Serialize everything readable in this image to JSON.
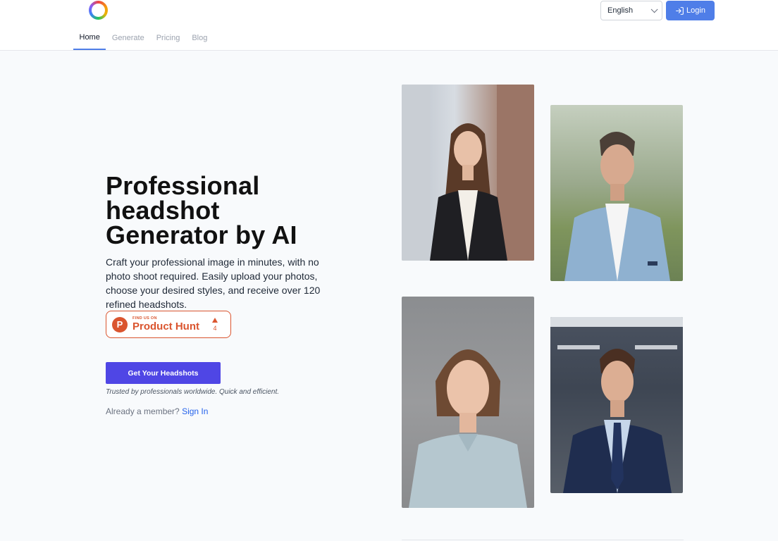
{
  "header": {
    "language": {
      "selected": "English"
    },
    "login_label": "Login"
  },
  "nav": {
    "items": [
      {
        "label": "Home",
        "active": true
      },
      {
        "label": "Generate",
        "active": false
      },
      {
        "label": "Pricing",
        "active": false
      },
      {
        "label": "Blog",
        "active": false
      }
    ]
  },
  "hero": {
    "title": "Professional headshot Generator by AI",
    "description": "Craft your professional image in minutes, with no photo shoot required. Easily upload your photos, choose your desired styles, and receive over 120 refined headshots.",
    "product_hunt": {
      "small": "FIND US ON",
      "name": "Product Hunt",
      "letter": "P",
      "votes": "4"
    },
    "cta_label": "Get Your Headshots",
    "trusted": "Trusted by professionals worldwide. Quick and efficient.",
    "member_prompt": "Already a member?",
    "signin_label": "Sign In"
  },
  "gallery": [
    {
      "name": "woman-black-blazer-photo"
    },
    {
      "name": "man-light-blue-suit-photo"
    },
    {
      "name": "woman-light-blue-shirt-photo"
    },
    {
      "name": "man-navy-suit-photo"
    }
  ],
  "colors": {
    "accent": "#4f7ee8",
    "cta": "#4f46e5",
    "product_hunt": "#da552f",
    "link": "#2563eb"
  }
}
